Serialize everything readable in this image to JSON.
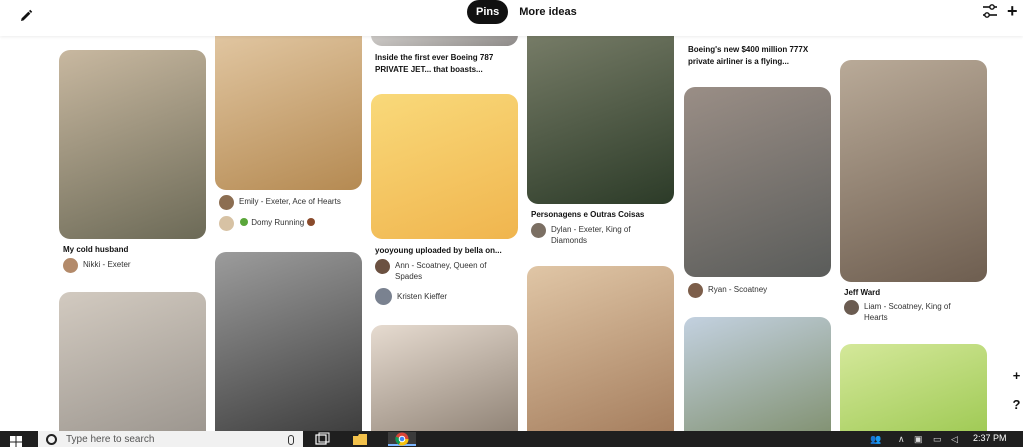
{
  "toolbar": {
    "pins_tab": "Pins",
    "more_ideas_tab": "More ideas"
  },
  "columns": [
    [
      {
        "title": "My cold husband",
        "attr": [
          {
            "text": "Nikki - Exeter",
            "color": "#b38a6a"
          }
        ],
        "colors": [
          "#6c6a57",
          "#c8b8a0"
        ]
      },
      {
        "title": "",
        "attr": [],
        "colors": [
          "#9a948d",
          "#d2cac0"
        ]
      }
    ],
    [
      {
        "title": "",
        "attr": [
          {
            "text": "Emily - Exeter, Ace of Hearts",
            "color": "#8c6e52"
          },
          {
            "text": "Domy Running",
            "color": "#d7c2a4",
            "emoji": true
          }
        ],
        "colors": [
          "#b58a52",
          "#e3c9a5"
        ]
      },
      {
        "title": "",
        "attr": [],
        "colors": [
          "#3a3a3a",
          "#9c9c9c"
        ]
      }
    ],
    [
      {
        "title": "Inside the first ever Boeing 787 PRIVATE JET... that boasts...",
        "attr": [],
        "colors": [
          "#8d8a88",
          "#d8d5d2"
        ]
      },
      {
        "title": "yooyoung uploaded by bella on...",
        "attr": [
          {
            "text": "Ann - Scoatney, Queen of Spades",
            "color": "#6b5141"
          },
          {
            "text": "Kristen Kieffer",
            "color": "#7a8290"
          }
        ],
        "colors": [
          "#f0b54e",
          "#f9d97a"
        ]
      },
      {
        "title": "",
        "attr": [],
        "colors": [
          "#8a7d70",
          "#e6dbd0"
        ]
      }
    ],
    [
      {
        "title": "Personagens e Outras Coisas",
        "attr": [
          {
            "text": "Dylan - Exeter, King of Diamonds",
            "color": "#7b6f63"
          }
        ],
        "colors": [
          "#2c3b28",
          "#7a7f6a"
        ]
      },
      {
        "title": "",
        "attr": [],
        "colors": [
          "#a27a5a",
          "#e0c6a6"
        ]
      }
    ],
    [
      {
        "title": "Boeing's new $400 million 777X private airliner is a flying...",
        "attr": [],
        "colors": [
          "#ffffff",
          "#ffffff"
        ]
      },
      {
        "title": "",
        "attr": [
          {
            "text": "Ryan - Scoatney",
            "color": "#7c5e4a"
          }
        ],
        "colors": [
          "#5a5c5a",
          "#9a8e86"
        ]
      },
      {
        "title": "",
        "attr": [],
        "colors": [
          "#7d8d6a",
          "#c3d1e0"
        ]
      }
    ],
    [
      {
        "title": "Jeff Ward",
        "attr": [
          {
            "text": "Liam - Scoatney, King of Hearts",
            "color": "#6b5c51"
          }
        ],
        "colors": [
          "#6e5e50",
          "#b9aa98"
        ]
      },
      {
        "title": "",
        "attr": [],
        "colors": [
          "#9cc850",
          "#d4e89a"
        ]
      }
    ]
  ],
  "side": {
    "add": "+",
    "help": "?"
  },
  "taskbar": {
    "search_placeholder": "Type here to search",
    "clock": "2:37 PM"
  }
}
